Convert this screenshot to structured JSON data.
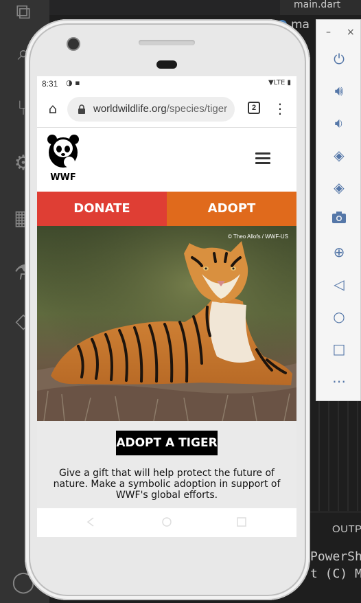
{
  "vscode": {
    "tab_label": "main.dart",
    "tab2_label": "ma",
    "panel_tab": "OUTP",
    "terminal_lines": [
      "PowerSh",
      "t (C) M"
    ]
  },
  "emulator": {
    "minimize": "–",
    "close": "×"
  },
  "status_bar": {
    "time": "8:31",
    "network": "LTE"
  },
  "browser": {
    "url_domain": "worldwildlife.org",
    "url_path": "/species/tiger",
    "tab_count": "2"
  },
  "site": {
    "logo_text": "WWF",
    "donate_label": "DONATE",
    "adopt_label": "ADOPT",
    "photo_credit": "© Theo Allofs / WWF-US",
    "adopt_heading": "ADOPT A TIGER",
    "description": "Give a gift that will help protect the future of nature. Make a symbolic adoption in support of WWF's global efforts."
  },
  "colors": {
    "donate": "#df3e34",
    "adopt": "#e06a1c"
  }
}
